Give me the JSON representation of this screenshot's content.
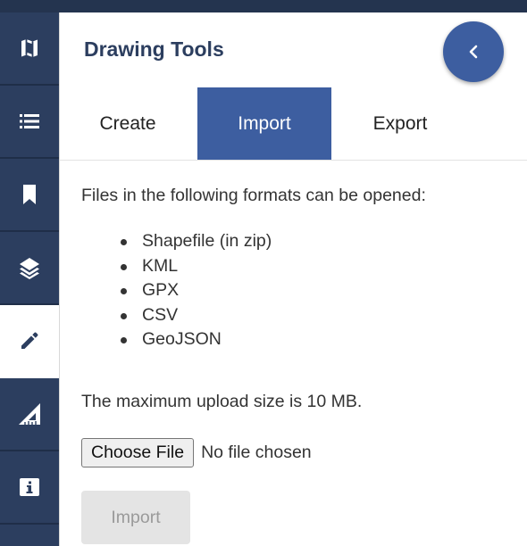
{
  "panel": {
    "title": "Drawing Tools",
    "collapse_icon": "chevron-left-icon"
  },
  "toolbar": {
    "items": [
      {
        "icon": "map-icon",
        "active": false
      },
      {
        "icon": "list-icon",
        "active": false
      },
      {
        "icon": "bookmark-icon",
        "active": false
      },
      {
        "icon": "layers-icon",
        "active": false
      },
      {
        "icon": "pencil-icon",
        "active": true
      },
      {
        "icon": "measure-icon",
        "active": false
      },
      {
        "icon": "info-icon",
        "active": false
      }
    ]
  },
  "tabs": [
    {
      "label": "Create",
      "active": false
    },
    {
      "label": "Import",
      "active": true
    },
    {
      "label": "Export",
      "active": false
    }
  ],
  "import": {
    "intro": "Files in the following formats can be opened:",
    "formats": [
      "Shapefile (in zip)",
      "KML",
      "GPX",
      "CSV",
      "GeoJSON"
    ],
    "max_size": "The maximum upload size is 10 MB.",
    "choose_file_label": "Choose File",
    "file_status": "No file chosen",
    "import_label": "Import"
  },
  "colors": {
    "accent": "#3d5ea0",
    "toolbar": "#2c3e5f",
    "title": "#2c3e5f"
  }
}
